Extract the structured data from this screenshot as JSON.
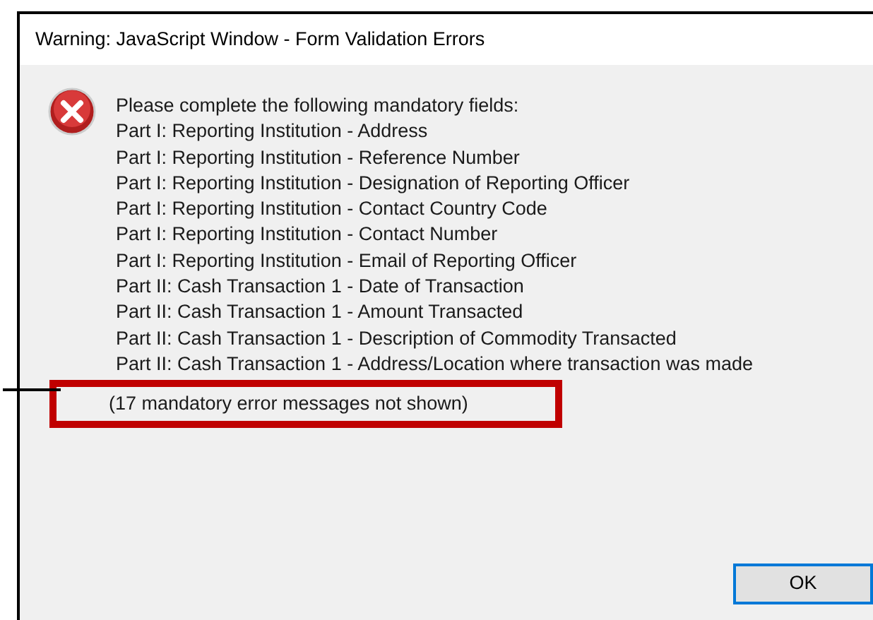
{
  "window": {
    "title": "Warning: JavaScript Window - Form Validation Errors"
  },
  "message": {
    "heading": "Please complete the following mandatory fields:",
    "fields": [
      "Part I: Reporting Institution - Address",
      "Part I: Reporting Institution - Reference Number",
      "Part I: Reporting Institution - Designation of Reporting Officer",
      "Part I: Reporting Institution - Contact Country Code",
      "Part I: Reporting Institution - Contact Number",
      "Part I: Reporting Institution - Email of Reporting Officer",
      "Part II: Cash Transaction 1 - Date of Transaction",
      "Part II: Cash Transaction 1 - Amount Transacted",
      "Part II: Cash Transaction 1 - Description of Commodity Transacted",
      "Part II: Cash Transaction 1 - Address/Location where transaction was made"
    ],
    "note": "(17 mandatory error messages not shown)"
  },
  "buttons": [
    {
      "label": "OK",
      "focused": true
    }
  ]
}
